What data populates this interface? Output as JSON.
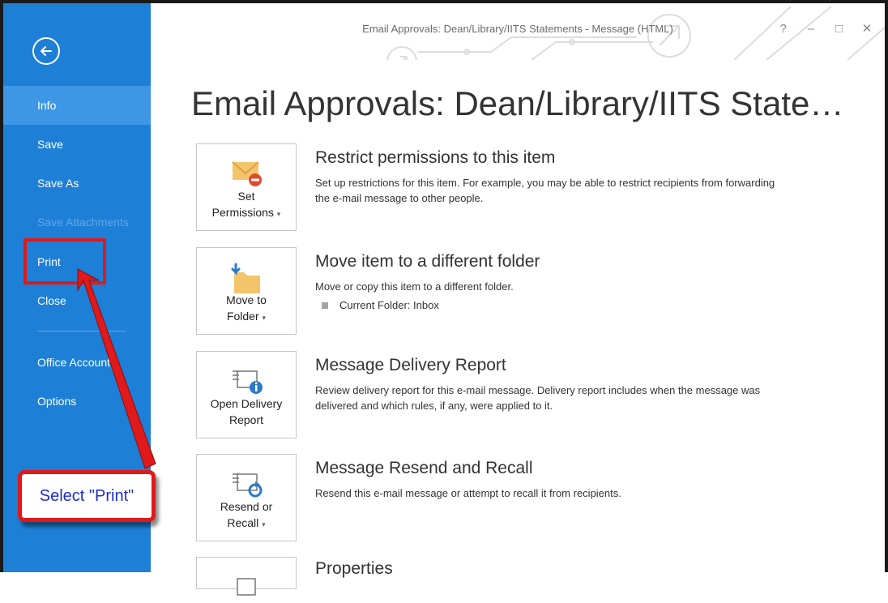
{
  "window": {
    "title": "Email Approvals: Dean/Library/IITS Statements - Message (HTML)",
    "controls": [
      "?",
      "–",
      "□",
      "✕"
    ]
  },
  "sidebar": {
    "back_icon": "back-arrow-icon",
    "items": [
      {
        "label": "Info",
        "state": "selected"
      },
      {
        "label": "Save",
        "state": "normal"
      },
      {
        "label": "Save As",
        "state": "normal"
      },
      {
        "label": "Save Attachments",
        "state": "disabled"
      },
      {
        "label": "Print",
        "state": "normal"
      },
      {
        "label": "Close",
        "state": "normal"
      },
      {
        "label": "Office Account",
        "state": "normal"
      },
      {
        "label": "Options",
        "state": "normal"
      }
    ]
  },
  "main": {
    "title": "Email Approvals: Dean/Library/IITS Statements",
    "sections": [
      {
        "button_line1": "Set",
        "button_line2": "Permissions",
        "icon": "envelope-restrict-icon",
        "title": "Restrict permissions to this item",
        "description": "Set up restrictions for this item. For example, you may be able to restrict recipients from forwarding the e-mail message to other people."
      },
      {
        "button_line1": "Move to",
        "button_line2": "Folder",
        "icon": "move-folder-icon",
        "title": "Move item to a different folder",
        "description": "Move or copy this item to a different folder.",
        "bullet": "Current Folder:  Inbox"
      },
      {
        "button_line1": "Open Delivery",
        "button_line2": "Report",
        "icon": "delivery-report-icon",
        "title": "Message Delivery Report",
        "description": "Review delivery report for this e-mail message. Delivery report includes when the message was delivered and which rules, if any, were applied to it."
      },
      {
        "button_line1": "Resend or",
        "button_line2": "Recall",
        "icon": "resend-recall-icon",
        "title": "Message Resend and Recall",
        "description": "Resend this e-mail message or attempt to recall it from recipients."
      },
      {
        "title": "Properties",
        "icon": "properties-icon"
      }
    ]
  },
  "annotation": {
    "callout_text": "Select \"Print\"",
    "color": "#e0191b",
    "text_color": "#1d2ecf"
  },
  "colors": {
    "sidebar": "#1e7fd6",
    "sidebar_selected": "#3d97e6"
  }
}
